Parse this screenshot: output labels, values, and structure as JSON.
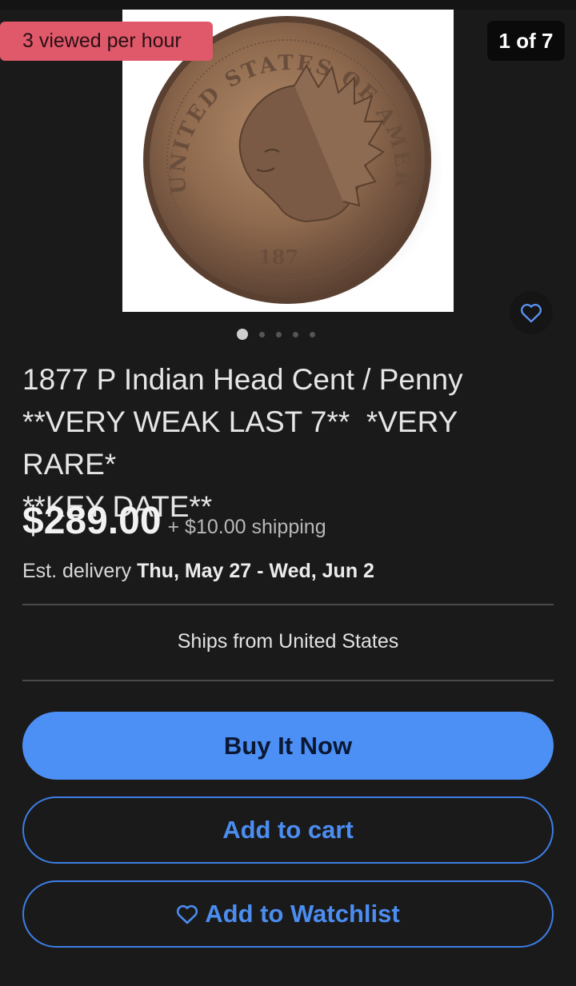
{
  "gallery": {
    "views_badge": "3 viewed per hour",
    "counter": "1 of 7",
    "total_dots": 5,
    "active_dot": 0
  },
  "coin_image": {
    "legend_text": "UNITED STATES OF AMERICA",
    "date_text": "187"
  },
  "listing": {
    "title": "1877 P Indian Head Cent / Penny\n**VERY WEAK LAST 7**  *VERY RARE*\n**KEY DATE**",
    "price": "$289.00",
    "shipping": "+ $10.00 shipping",
    "delivery_label": "Est. delivery",
    "delivery_dates": "Thu, May 27 - Wed, Jun 2",
    "ships_from": "Ships from United States"
  },
  "actions": {
    "buy_now": "Buy It Now",
    "add_to_cart": "Add to cart",
    "add_to_watchlist": "Add to Watchlist"
  },
  "icons": {
    "favorite": "heart-outline-icon",
    "watchlist": "heart-outline-icon"
  },
  "colors": {
    "background": "#1a1a1a",
    "badge": "#e0596a",
    "accent_blue": "#4c8ff5",
    "link_blue": "#4b8df0"
  }
}
